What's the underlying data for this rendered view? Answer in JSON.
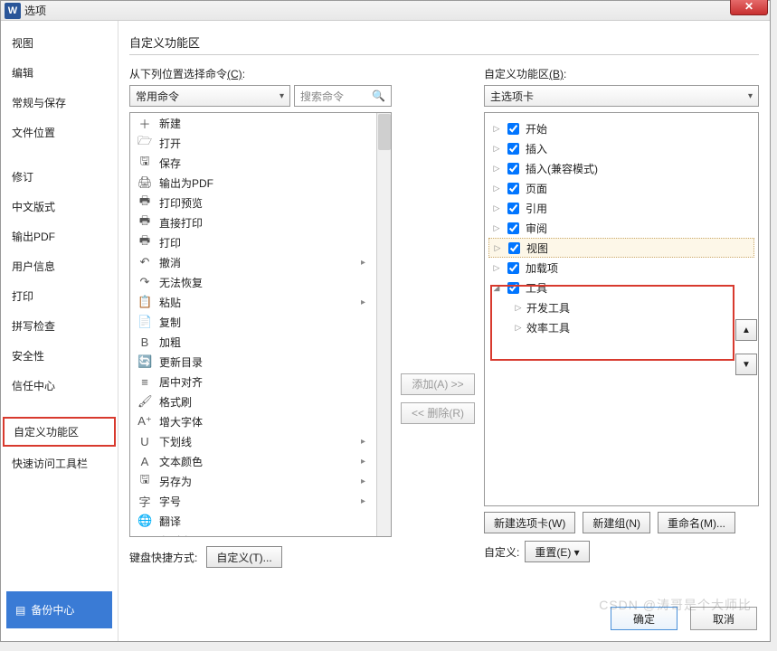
{
  "window": {
    "title": "选项"
  },
  "sidebar": {
    "items": [
      "视图",
      "编辑",
      "常规与保存",
      "文件位置",
      "修订",
      "中文版式",
      "输出PDF",
      "用户信息",
      "打印",
      "拼写检查",
      "安全性",
      "信任中心",
      "自定义功能区",
      "快速访问工具栏"
    ],
    "selected_index": 12,
    "backup": "备份中心"
  },
  "main": {
    "heading": "自定义功能区",
    "left": {
      "label_pre": "从下列位置选择命令",
      "label_key": "(C)",
      "select": "常用命令",
      "search_placeholder": "搜索命令",
      "commands": [
        {
          "icon": "＋",
          "label": "新建"
        },
        {
          "icon": "🗁",
          "label": "打开"
        },
        {
          "icon": "🖫",
          "label": "保存"
        },
        {
          "icon": "🖨",
          "label": "输出为PDF"
        },
        {
          "icon": "🖶",
          "label": "打印预览"
        },
        {
          "icon": "🖶",
          "label": "直接打印"
        },
        {
          "icon": "🖶",
          "label": "打印"
        },
        {
          "icon": "↶",
          "label": "撤消",
          "sub": true
        },
        {
          "icon": "↷",
          "label": "无法恢复"
        },
        {
          "icon": "📋",
          "label": "粘贴",
          "sub": true
        },
        {
          "icon": "📄",
          "label": "复制"
        },
        {
          "icon": "B",
          "label": "加粗"
        },
        {
          "icon": "🔄",
          "label": "更新目录"
        },
        {
          "icon": "≡",
          "label": "居中对齐"
        },
        {
          "icon": "🖌",
          "label": "格式刷"
        },
        {
          "icon": "A⁺",
          "label": "增大字体"
        },
        {
          "icon": "U",
          "label": "下划线",
          "sub": true
        },
        {
          "icon": "A",
          "label": "文本颜色",
          "sub": true
        },
        {
          "icon": "🖫",
          "label": "另存为",
          "sub": true
        },
        {
          "icon": "字",
          "label": "字号",
          "sub": true
        },
        {
          "icon": "🌐",
          "label": "翻译"
        },
        {
          "icon": "≡",
          "label": "左对齐"
        }
      ]
    },
    "mid": {
      "add": "添加(A) >>",
      "remove": "<< 删除(R)"
    },
    "right": {
      "label_pre": "自定义功能区",
      "label_key": "(B)",
      "select": "主选项卡",
      "tree": [
        {
          "exp": "▷",
          "checked": true,
          "label": "开始"
        },
        {
          "exp": "▷",
          "checked": true,
          "label": "插入"
        },
        {
          "exp": "▷",
          "checked": true,
          "label": "插入(兼容模式)"
        },
        {
          "exp": "▷",
          "checked": true,
          "label": "页面"
        },
        {
          "exp": "▷",
          "checked": true,
          "label": "引用"
        },
        {
          "exp": "▷",
          "checked": true,
          "label": "审阅"
        },
        {
          "exp": "▷",
          "checked": true,
          "label": "视图",
          "selected": true
        },
        {
          "exp": "▷",
          "checked": true,
          "label": "加载项"
        },
        {
          "exp": "◢",
          "checked": true,
          "label": "工具"
        },
        {
          "exp": "▷",
          "indent": true,
          "label": "开发工具"
        },
        {
          "exp": "▷",
          "indent": true,
          "label": "效率工具"
        }
      ],
      "buttons": {
        "newtab": "新建选项卡(W)",
        "newgroup": "新建组(N)",
        "rename": "重命名(M)..."
      },
      "reset_label": "自定义:",
      "reset_btn": "重置(E) ▾"
    },
    "kb": {
      "label": "键盘快捷方式:",
      "btn": "自定义(T)..."
    },
    "footer": {
      "ok": "确定",
      "cancel": "取消"
    }
  },
  "watermark": "CSDN @涛哥是个大师比"
}
